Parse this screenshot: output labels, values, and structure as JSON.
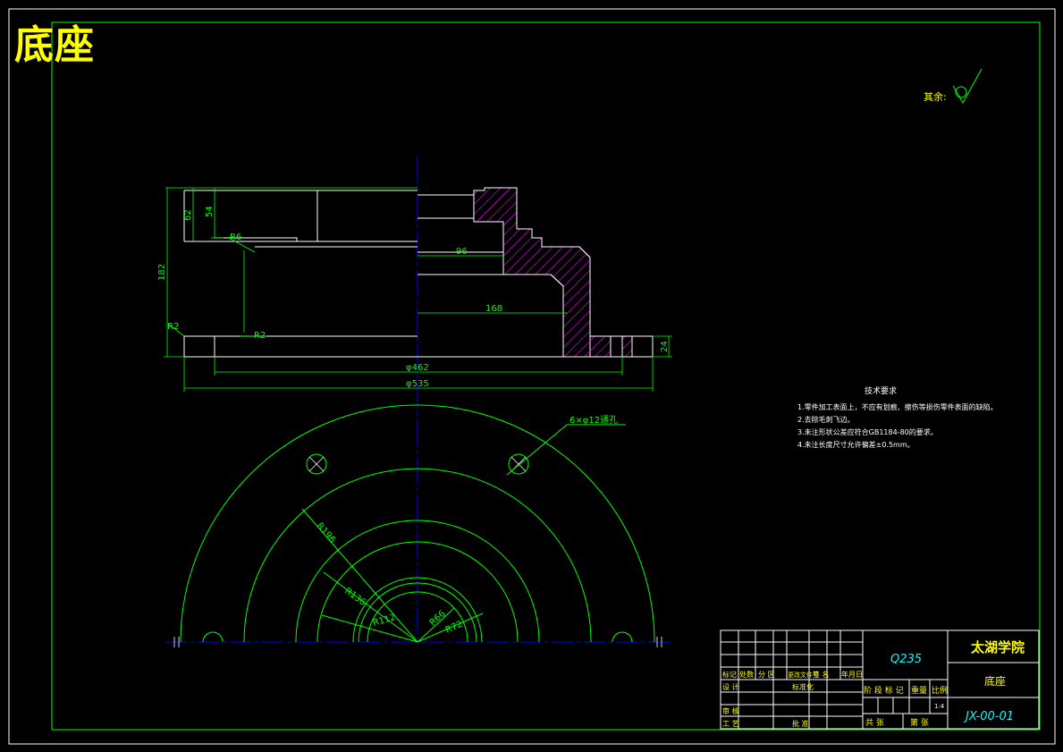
{
  "drawing": {
    "title": "底座",
    "roughness_label": "其余:",
    "colors": {
      "border": "#00ff00",
      "outline": "#ffffff",
      "dimension": "#00ff00",
      "centerline": "#0000ff",
      "hatch": "#ff00ff",
      "title_text": "#ffff00",
      "tb_text": "#00ffff"
    },
    "dimensions": {
      "d62": "62",
      "d54": "54",
      "d182": "182",
      "r6": "R6",
      "r2a": "R2",
      "r2b": "R2",
      "d96": "96",
      "d168": "168",
      "d24": "24",
      "phi462": "φ462",
      "phi535": "φ535",
      "holes": "6×φ12通孔",
      "r196": "R196",
      "r136": "R136",
      "r112": "R112",
      "r66": "R66",
      "r72": "R72"
    },
    "tech_requirements": {
      "heading": "技术要求",
      "items": [
        "1.零件加工表面上，不应有划痕、擦伤等损伤零件表面的缺陷。",
        "2.去除毛刺飞边。",
        "3.未注形状公差应符合GB1184-80的要求。",
        "4.未注长度尺寸允许偏差±0.5mm。"
      ]
    },
    "title_block": {
      "material": "Q235",
      "school": "太湖学院",
      "part_name": "底座",
      "drawing_no": "JX-00-01",
      "row_labels": [
        "标记",
        "处数",
        "分 区",
        "更改文件号",
        "签 名",
        "年月日"
      ],
      "design_label": "设 计",
      "standard_label": "标准化",
      "check_label": "审 核",
      "process_label": "工 艺",
      "approve_label": "批 准",
      "stage_label": "阶 段 标 记",
      "weight_label": "重量",
      "scale_label": "比例",
      "sheet_total_label": "共   张",
      "sheet_no_label": "第   张",
      "scale_value": "1:4"
    }
  }
}
